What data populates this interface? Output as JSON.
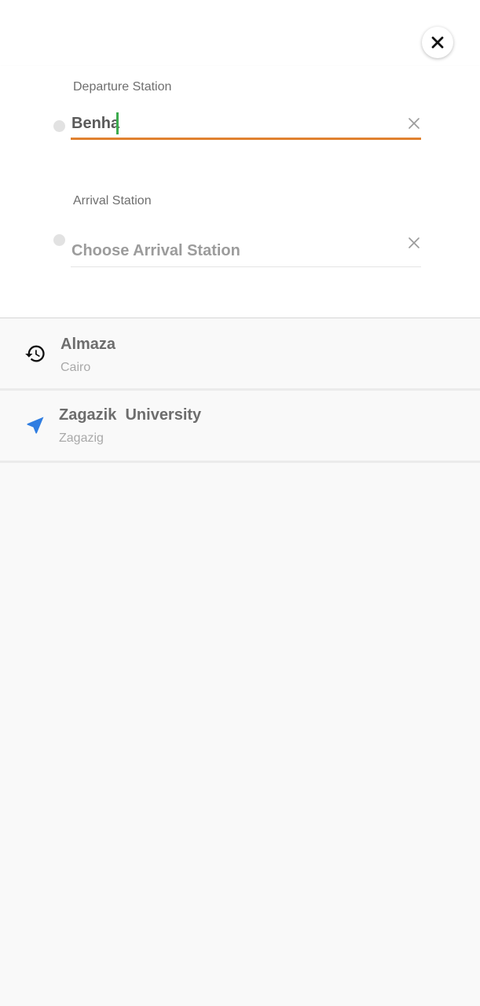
{
  "header": {
    "close_icon": "close-icon"
  },
  "departure": {
    "label": "Departure Station",
    "value": "Benha",
    "accent_color": "#e0812f",
    "caret_color": "#3cab4e",
    "clear_icon": "clear-icon"
  },
  "arrival": {
    "label": "Arrival Station",
    "value": "",
    "placeholder": "Choose Arrival Station",
    "clear_icon": "clear-icon"
  },
  "results": [
    {
      "icon": "history-icon",
      "title": "Almaza",
      "subtitle": "Cairo"
    },
    {
      "icon": "navigation-arrow-icon",
      "title": "Zagazik  University",
      "subtitle": "Zagazig",
      "icon_color": "#2f7de1"
    }
  ]
}
